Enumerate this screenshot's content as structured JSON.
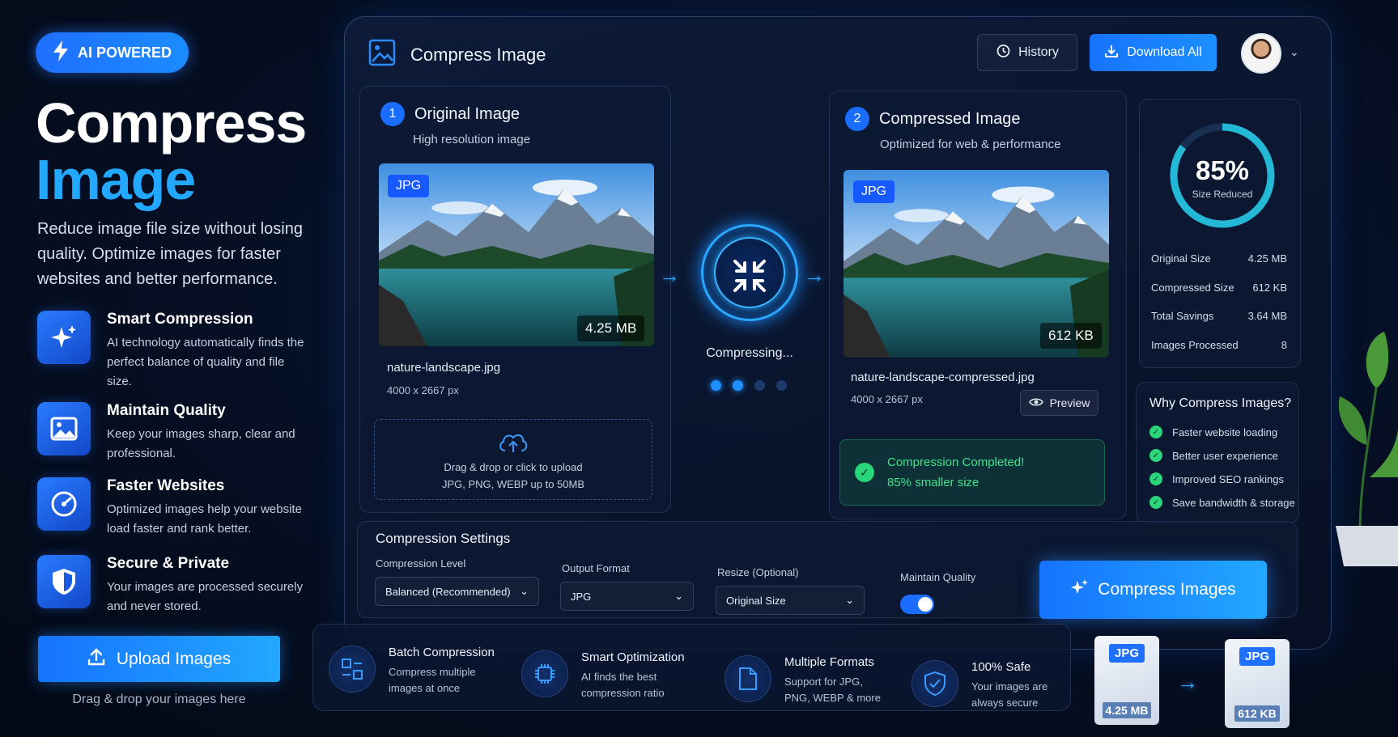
{
  "hero": {
    "badge": "AI POWERED",
    "title_line1": "Compress",
    "title_line2": "Image",
    "lead": "Reduce image file size without losing quality. Optimize images for faster websites and better performance.",
    "features": [
      {
        "icon": "sparkles-icon",
        "title": "Smart Compression",
        "desc": "AI technology automatically finds the perfect balance of quality and file size."
      },
      {
        "icon": "image-icon",
        "title": "Maintain Quality",
        "desc": "Keep your images sharp, clear and professional."
      },
      {
        "icon": "speedometer-icon",
        "title": "Faster Websites",
        "desc": "Optimized images help your website load faster and rank better."
      },
      {
        "icon": "shield-icon",
        "title": "Secure & Private",
        "desc": "Your images are processed securely and never stored."
      }
    ],
    "upload_button": "Upload Images",
    "upload_hint": "Drag & drop your images here"
  },
  "window": {
    "title": "Compress Image",
    "history": "History",
    "download_all": "Download All"
  },
  "original": {
    "step": "1",
    "title": "Original Image",
    "subtitle": "High resolution image",
    "format": "JPG",
    "size": "4.25 MB",
    "filename": "nature-landscape.jpg",
    "dimensions": "4000 x 2667 px",
    "drop_line1": "Drag & drop or click to upload",
    "drop_line2": "JPG, PNG, WEBP up to 50MB"
  },
  "process": {
    "status": "Compressing...",
    "progress_step": 2,
    "progress_total": 4
  },
  "compressed": {
    "step": "2",
    "title": "Compressed Image",
    "subtitle": "Optimized for web & performance",
    "format": "JPG",
    "size": "612 KB",
    "filename": "nature-landscape-compressed.jpg",
    "dimensions": "4000 x 2667 px",
    "preview": "Preview",
    "done_title": "Compression Completed!",
    "done_sub": "85% smaller size"
  },
  "stats": {
    "percent": "85%",
    "percent_value": 85,
    "percent_label": "Size Reduced",
    "rows": [
      {
        "label": "Original Size",
        "value": "4.25 MB"
      },
      {
        "label": "Compressed Size",
        "value": "612 KB"
      },
      {
        "label": "Total Savings",
        "value": "3.64 MB"
      },
      {
        "label": "Images Processed",
        "value": "8"
      }
    ]
  },
  "why": {
    "title": "Why Compress Images?",
    "items": [
      "Faster website loading",
      "Better user experience",
      "Improved SEO rankings",
      "Save bandwidth & storage"
    ]
  },
  "settings": {
    "title": "Compression Settings",
    "level_label": "Compression Level",
    "level_value": "Balanced (Recommended)",
    "format_label": "Output Format",
    "format_value": "JPG",
    "resize_label": "Resize (Optional)",
    "resize_value": "Original Size",
    "quality_label": "Maintain Quality",
    "quality_on": true,
    "compress_button": "Compress Images"
  },
  "bottom": [
    {
      "icon": "batch-icon",
      "title": "Batch Compression",
      "desc1": "Compress multiple",
      "desc2": "images at once"
    },
    {
      "icon": "chip-icon",
      "title": "Smart Optimization",
      "desc1": "AI finds the best",
      "desc2": "compression ratio"
    },
    {
      "icon": "file-icon",
      "title": "Multiple Formats",
      "desc1": "Support for JPG,",
      "desc2": "PNG, WEBP & more"
    },
    {
      "icon": "shield-check-icon",
      "title": "100% Safe",
      "desc1": "Your images are",
      "desc2": "always secure"
    }
  ],
  "files": {
    "before_type": "JPG",
    "before_size": "4.25 MB",
    "after_type": "JPG",
    "after_size": "612 KB"
  },
  "colors": {
    "accent": "#1b6dff",
    "success": "#2bd67b",
    "bg": "#061026"
  }
}
